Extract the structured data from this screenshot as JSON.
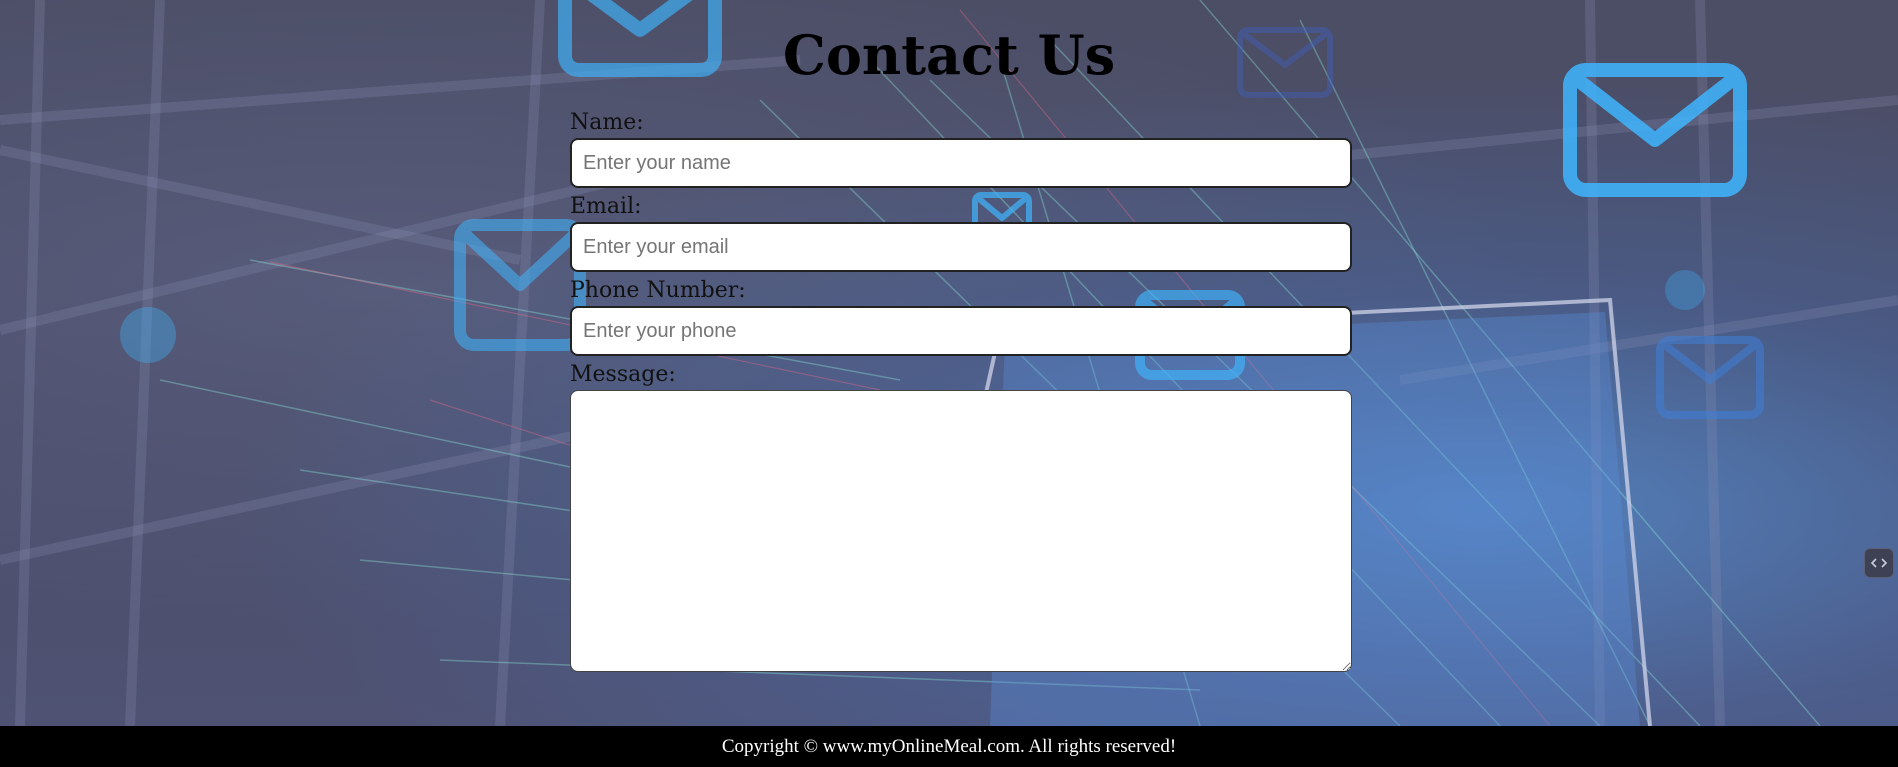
{
  "page": {
    "title": "Contact Us"
  },
  "form": {
    "name": {
      "label": "Name:",
      "placeholder": "Enter your name",
      "value": ""
    },
    "email": {
      "label": "Email:",
      "placeholder": "Enter your email",
      "value": ""
    },
    "phone": {
      "label": "Phone Number:",
      "placeholder": "Enter your phone",
      "value": ""
    },
    "message": {
      "label": "Message:",
      "value": ""
    }
  },
  "side_widget": {
    "icon": "code-icon"
  },
  "footer": {
    "copyright": "Copyright © www.myOnlineMeal.com. All rights reserved!"
  },
  "colors": {
    "background": "#4c4e66",
    "accent_glow": "#5aaaff",
    "footer_bg": "#000000",
    "footer_text": "#ffffff"
  }
}
